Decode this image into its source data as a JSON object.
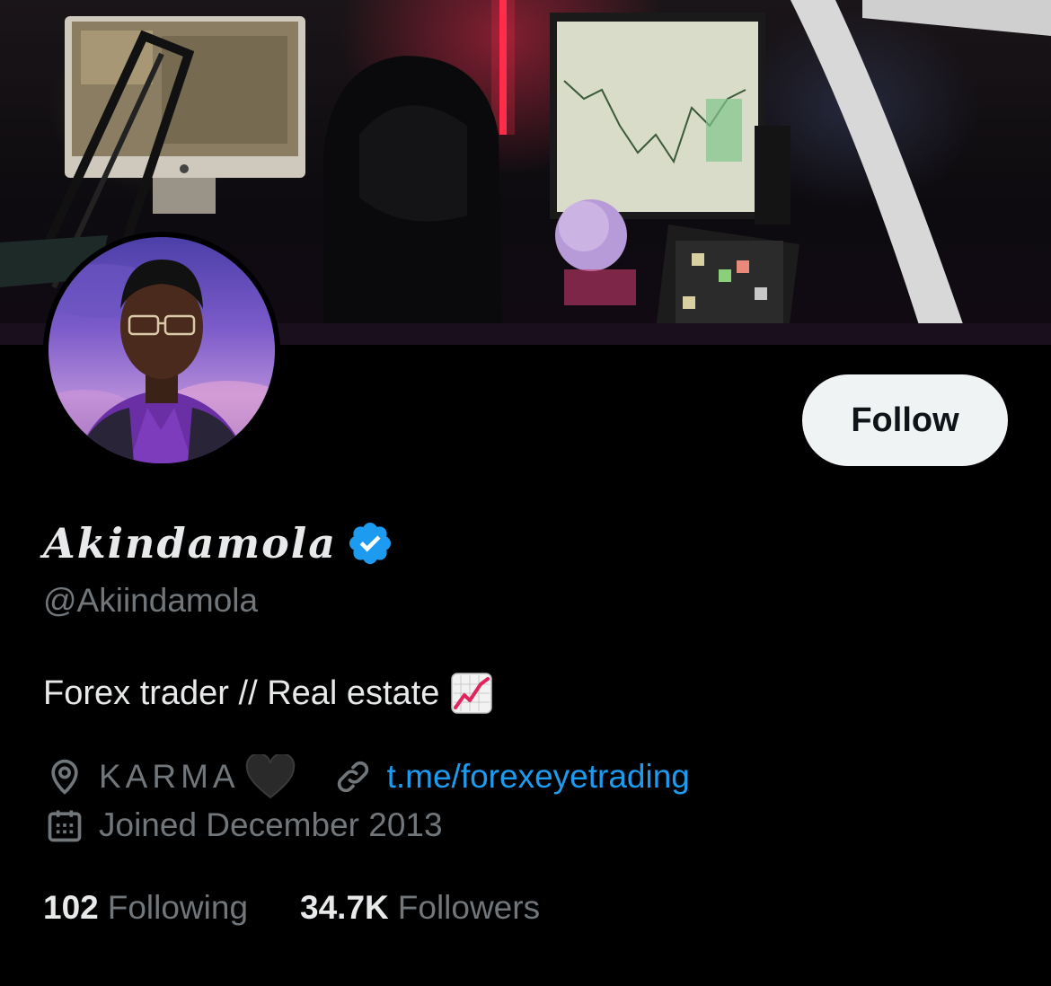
{
  "profile": {
    "display_name": "Akindamola",
    "handle": "@Akiindamola",
    "bio": "Forex trader // Real estate",
    "bio_emoji": "chart-increasing-icon",
    "location": "KARMA",
    "location_emoji": "black-heart-icon",
    "link": "t.me/forexeyetrading",
    "joined": "Joined December 2013",
    "verified": true
  },
  "actions": {
    "follow_label": "Follow"
  },
  "stats": {
    "following_count": "102",
    "following_label": "Following",
    "followers_count": "34.7K",
    "followers_label": "Followers"
  },
  "colors": {
    "background": "#000000",
    "text_primary": "#e7e9ea",
    "text_secondary": "#71767b",
    "link": "#1d9bf0",
    "verified_badge": "#1d9bf0",
    "follow_button_bg": "#eff3f4"
  }
}
